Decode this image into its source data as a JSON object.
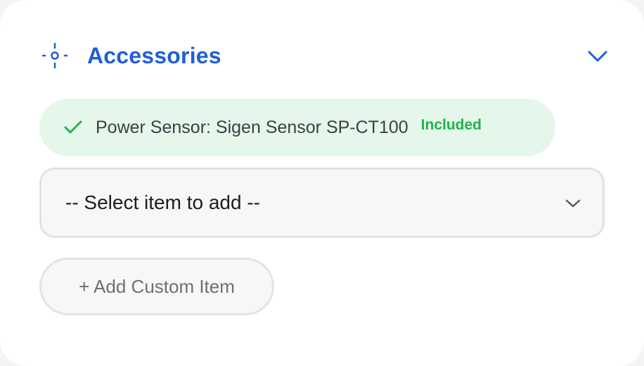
{
  "colors": {
    "accent": "#1f5fd6",
    "included_bg": "#e4f7ea",
    "included_text": "#22b24c"
  },
  "header": {
    "icon": "crosshair-icon",
    "title": "Accessories",
    "toggle_icon": "chevron-down-icon"
  },
  "included_items": [
    {
      "icon": "checkmark-icon",
      "name": "Power Sensor: Sigen Sensor SP-CT100",
      "badge": "Included"
    }
  ],
  "add_select": {
    "selected": "-- Select item to add --",
    "icon": "chevron-down-icon"
  },
  "add_custom": {
    "label": "+ Add Custom Item"
  }
}
